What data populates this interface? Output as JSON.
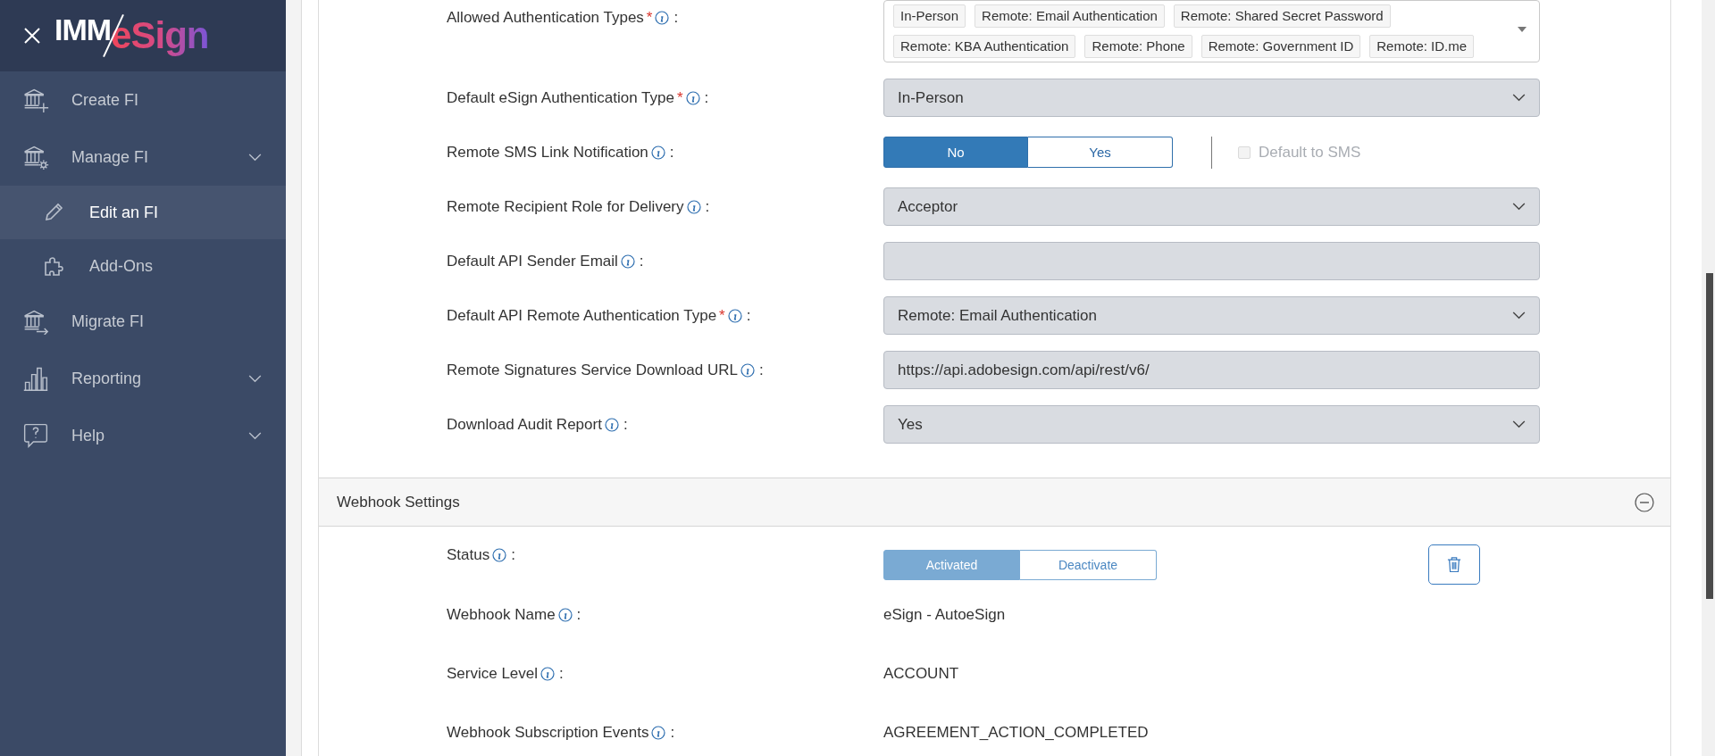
{
  "sidebar": {
    "logo": {
      "left": "IMM",
      "right": "eSign"
    },
    "items": [
      {
        "label": "Create FI",
        "selected": false
      },
      {
        "label": "Manage FI",
        "selected": false,
        "kind": "group",
        "children": [
          {
            "label": "Edit an FI",
            "selected": true
          },
          {
            "label": "Add-Ons",
            "selected": false
          }
        ]
      },
      {
        "label": "Migrate FI",
        "selected": false
      },
      {
        "label": "Reporting",
        "selected": false,
        "kind": "group"
      },
      {
        "label": "Help",
        "selected": false,
        "kind": "group"
      }
    ]
  },
  "label_suffix": ":",
  "required_mark": "*",
  "settings": {
    "fields": [
      {
        "kind": "tags",
        "label": "Allowed Authentication Types",
        "required": true,
        "tags": [
          "In-Person",
          "Remote: Email Authentication",
          "Remote: Shared Secret Password",
          "Remote: KBA Authentication",
          "Remote: Phone",
          "Remote: Government ID",
          "Remote: ID.me"
        ]
      },
      {
        "kind": "select",
        "label": "Default eSign Authentication Type",
        "required": true,
        "value": "In-Person"
      },
      {
        "kind": "toggle",
        "label": "Remote SMS Link Notification",
        "required": false,
        "disabled": false,
        "options": [
          {
            "label": "No",
            "selected": true
          },
          {
            "label": "Yes",
            "selected": false
          }
        ],
        "checkbox": {
          "label": "Default to SMS",
          "checked": false,
          "disabled": true
        }
      },
      {
        "kind": "select",
        "label": "Remote Recipient Role for Delivery",
        "required": false,
        "value": "Acceptor"
      },
      {
        "kind": "input",
        "label": "Default API Sender Email",
        "required": false
      },
      {
        "kind": "select",
        "label": "Default API Remote Authentication Type",
        "required": true,
        "value": "Remote: Email Authentication"
      },
      {
        "kind": "input",
        "label": "Remote Signatures Service Download URL",
        "required": false,
        "value": "https://api.adobesign.com/api/rest/v6/"
      },
      {
        "kind": "select",
        "label": "Download Audit Report",
        "required": false,
        "value": "Yes"
      }
    ]
  },
  "webhook": {
    "title": "Webhook Settings",
    "expanded": true,
    "fields": [
      {
        "kind": "toggle",
        "label": "Status",
        "required": false,
        "disabled": true,
        "deletable": true,
        "options": [
          {
            "label": "Activated",
            "selected": true
          },
          {
            "label": "Deactivate",
            "selected": false
          }
        ]
      },
      {
        "kind": "text",
        "label": "Webhook Name",
        "required": false,
        "value": "eSign - AutoeSign"
      },
      {
        "kind": "text",
        "label": "Service Level",
        "required": false,
        "value": "ACCOUNT"
      },
      {
        "kind": "text",
        "label": "Webhook Subscription Events",
        "required": false,
        "value": "AGREEMENT_ACTION_COMPLETED"
      }
    ]
  }
}
